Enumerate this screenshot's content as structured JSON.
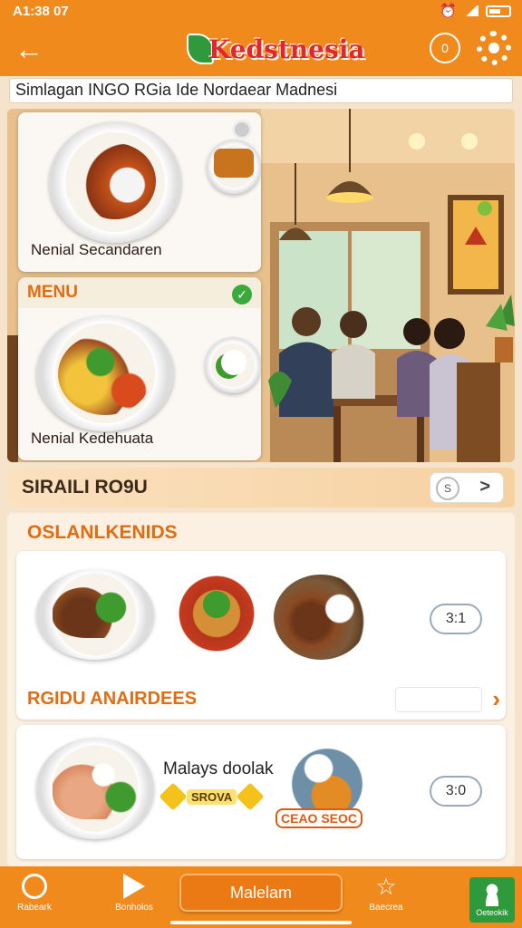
{
  "status_bar": {
    "time": "A1:38 07"
  },
  "app_bar": {
    "logo_text": "Kedstnesia",
    "info_label": "0"
  },
  "search": {
    "text": "Simlagan INGO RGia Ide Nordaear Madnesi"
  },
  "hero": {
    "card1_caption": "Nenial Secandaren",
    "card2_label": "MENU",
    "card2_caption": "Nenial Kedehuata"
  },
  "section": {
    "title": "SIRAILI RO9U",
    "pill_icon": "S",
    "pill_arrow": ">"
  },
  "list": {
    "title": "OSLANLKENIDS",
    "item1": {
      "subtitle": "RGIDU ANAIRDEES",
      "qty": "3:1"
    },
    "item2": {
      "name": "Malays doolak",
      "tag": "SROVA",
      "sticker": "CEAO SEOC",
      "qty": "3:0"
    }
  },
  "nav": {
    "item1": "Rabeark",
    "item2": "Bonholos",
    "main_button": "Malelam",
    "item4": "Baecrea",
    "profile": "Oeteokik"
  },
  "colors": {
    "primary": "#f08a1d",
    "accent": "#e06d12",
    "green": "#2e9a3c"
  }
}
